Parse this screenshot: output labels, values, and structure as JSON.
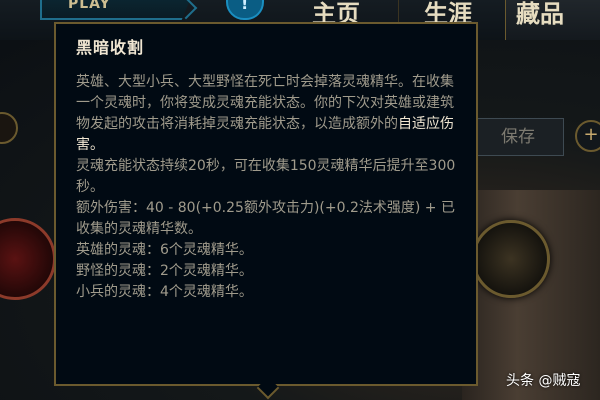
{
  "topbar": {
    "play_label": "PLAY",
    "tabs": [
      {
        "label": "主页"
      },
      {
        "label": "生涯"
      },
      {
        "label": "藏品"
      }
    ],
    "alert_icon": "alert-icon"
  },
  "client": {
    "save_label": "保存",
    "add_label": "+"
  },
  "tooltip": {
    "title": "黑暗收割",
    "paragraphs": [
      {
        "pre": "英雄、大型小兵、大型野怪在死亡时会掉落灵魂精华。在收集一个灵魂时，你将变成灵魂充能状态。你的下次对英雄或建筑物发起的攻击将消耗掉灵魂充能状态，以造成额外的",
        "highlight": "自适应伤害",
        "post": "。"
      },
      {
        "text": "灵魂充能状态持续20秒，可在收集150灵魂精华后提升至300秒。"
      },
      {
        "text": "额外伤害：40 - 80(+0.25额外攻击力)(+0.2法术强度) + 已收集的灵魂精华数。"
      },
      {
        "text": "英雄的灵魂：6个灵魂精华。"
      },
      {
        "text": "野怪的灵魂：2个灵魂精华。"
      },
      {
        "text": "小兵的灵魂：4个灵魂精华。"
      }
    ]
  },
  "watermark": "头条 @贼寇",
  "colors": {
    "gold_border": "#6b5a2e",
    "tooltip_bg": "#010a13",
    "body_text": "#a09b8c",
    "highlight_text": "#f0e6d2"
  }
}
